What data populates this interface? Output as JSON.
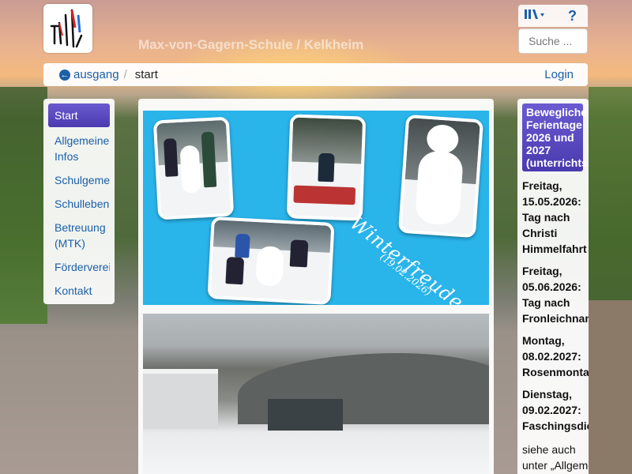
{
  "site": {
    "school_name": "Max-von-Gagern-Schule / Kelkheim",
    "logo_icon": "school-logo-icon"
  },
  "header": {
    "language_icon": "language-icon",
    "help_label": "?",
    "search_placeholder": "Suche ..."
  },
  "breadcrumb": {
    "back_label": "ausgang",
    "separator": "/",
    "current": "start",
    "login_label": "Login"
  },
  "sidebar": {
    "items": [
      {
        "label": "Start",
        "active": true
      },
      {
        "label": "Allgemeine Infos"
      },
      {
        "label": "Schulgemeinde"
      },
      {
        "label": "Schulleben"
      },
      {
        "label": "Betreuung (MTK)"
      },
      {
        "label": "Förderverein"
      },
      {
        "label": "Kontakt"
      }
    ]
  },
  "main": {
    "banner_title": "Winterfreude",
    "banner_date": "(19.02.2026)"
  },
  "rightbox": {
    "heading_lines": [
      "Bewegliche",
      "Ferientage",
      "2026 und",
      "2027",
      "(unterrichtsfrei)"
    ],
    "entries": [
      {
        "lines": [
          "Freitag,",
          "15.05.2026:",
          "Tag nach",
          "Christi",
          "Himmelfahrt"
        ]
      },
      {
        "lines": [
          "Freitag,",
          "05.06.2026:",
          "Tag nach",
          "Fronleichnam"
        ]
      },
      {
        "lines": [
          "Montag,",
          "08.02.2027:",
          "Rosenmontag"
        ]
      },
      {
        "lines": [
          "Dienstag,",
          "09.02.2027:",
          "Faschingsdienstag"
        ]
      }
    ],
    "note_lines": [
      "siehe auch",
      "unter „Allgemeine"
    ]
  },
  "colors": {
    "link": "#1b5fa8",
    "accent": "#4a3ab0",
    "banner_bg": "#29b4ea"
  }
}
